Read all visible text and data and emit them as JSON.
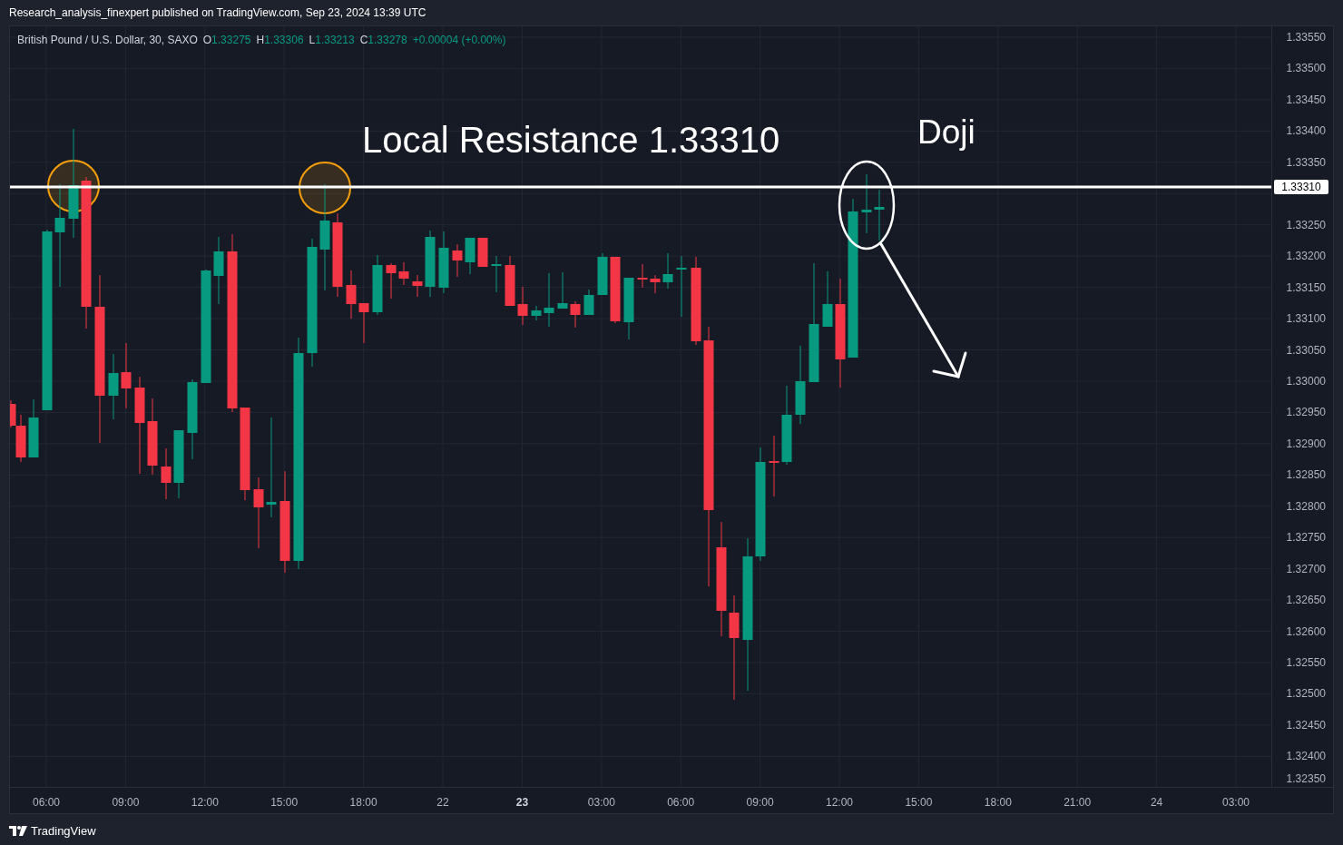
{
  "header": {
    "attribution": "Research_analysis_finexpert published on TradingView.com, Sep 23, 2024 13:39 UTC"
  },
  "legend": {
    "symbol": "British Pound / U.S. Dollar, 30, SAXO",
    "ohlc": [
      {
        "label": "O",
        "value": "1.33275"
      },
      {
        "label": "H",
        "value": "1.33306"
      },
      {
        "label": "L",
        "value": "1.33213"
      },
      {
        "label": "C",
        "value": "1.33278"
      }
    ],
    "change": "+0.00004 (+0.00%)"
  },
  "annotations": [
    {
      "kind": "label",
      "text": "Local Resistance 1.33310"
    },
    {
      "kind": "label",
      "text": "Doji"
    }
  ],
  "price_axis": {
    "ticks": [
      {
        "kind": "tick",
        "label": "1.33550"
      },
      {
        "kind": "tick",
        "label": "1.33500"
      },
      {
        "kind": "tick",
        "label": "1.33450"
      },
      {
        "kind": "tick",
        "label": "1.33400"
      },
      {
        "kind": "tick",
        "label": "1.33350"
      },
      {
        "kind": "current",
        "label": "1.33310"
      },
      {
        "kind": "tick",
        "label": "1.33250"
      },
      {
        "kind": "tick",
        "label": "1.33200"
      },
      {
        "kind": "tick",
        "label": "1.33150"
      },
      {
        "kind": "tick",
        "label": "1.33100"
      },
      {
        "kind": "tick",
        "label": "1.33050"
      },
      {
        "kind": "tick",
        "label": "1.33000"
      },
      {
        "kind": "tick",
        "label": "1.32950"
      },
      {
        "kind": "tick",
        "label": "1.32900"
      },
      {
        "kind": "tick",
        "label": "1.32850"
      },
      {
        "kind": "tick",
        "label": "1.32800"
      },
      {
        "kind": "tick",
        "label": "1.32750"
      },
      {
        "kind": "tick",
        "label": "1.32700"
      },
      {
        "kind": "tick",
        "label": "1.32650"
      },
      {
        "kind": "tick",
        "label": "1.32600"
      },
      {
        "kind": "tick",
        "label": "1.32550"
      },
      {
        "kind": "tick",
        "label": "1.32500"
      },
      {
        "kind": "tick",
        "label": "1.32450"
      },
      {
        "kind": "tick",
        "label": "1.32400"
      },
      {
        "kind": "tick",
        "label": "1.32350"
      }
    ]
  },
  "time_axis": {
    "ticks": [
      {
        "label": "06:00",
        "bold": false
      },
      {
        "label": "09:00",
        "bold": false
      },
      {
        "label": "12:00",
        "bold": false
      },
      {
        "label": "15:00",
        "bold": false
      },
      {
        "label": "18:00",
        "bold": false
      },
      {
        "label": "22",
        "bold": false
      },
      {
        "label": "23",
        "bold": true
      },
      {
        "label": "03:00",
        "bold": false
      },
      {
        "label": "06:00",
        "bold": false
      },
      {
        "label": "09:00",
        "bold": false
      },
      {
        "label": "12:00",
        "bold": false
      },
      {
        "label": "15:00",
        "bold": false
      },
      {
        "label": "18:00",
        "bold": false
      },
      {
        "label": "21:00",
        "bold": false
      },
      {
        "label": "24",
        "bold": false
      },
      {
        "label": "03:00",
        "bold": false
      }
    ]
  },
  "footer": {
    "brand": "TradingView"
  }
}
